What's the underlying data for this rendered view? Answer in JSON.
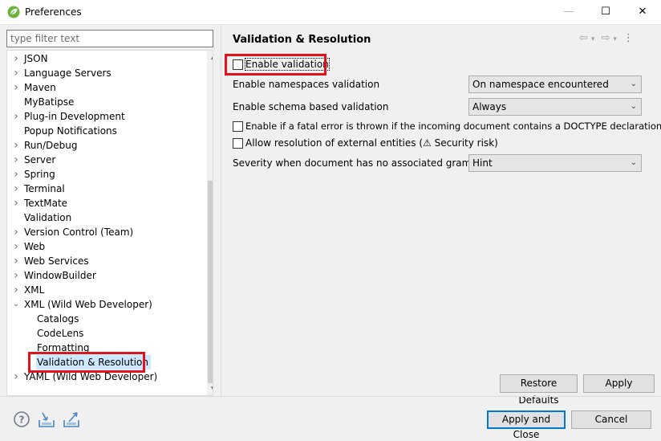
{
  "window": {
    "title": "Preferences",
    "minimize": "—",
    "maximize": "☐",
    "close": "✕"
  },
  "filter": {
    "placeholder": "type filter text"
  },
  "tree": {
    "items": [
      {
        "label": "JSON",
        "expandable": true
      },
      {
        "label": "Language Servers",
        "expandable": true
      },
      {
        "label": "Maven",
        "expandable": true
      },
      {
        "label": "MyBatipse",
        "expandable": false
      },
      {
        "label": "Plug-in Development",
        "expandable": true
      },
      {
        "label": "Popup Notifications",
        "expandable": false
      },
      {
        "label": "Run/Debug",
        "expandable": true
      },
      {
        "label": "Server",
        "expandable": true
      },
      {
        "label": "Spring",
        "expandable": true
      },
      {
        "label": "Terminal",
        "expandable": true
      },
      {
        "label": "TextMate",
        "expandable": true
      },
      {
        "label": "Validation",
        "expandable": false
      },
      {
        "label": "Version Control (Team)",
        "expandable": true
      },
      {
        "label": "Web",
        "expandable": true
      },
      {
        "label": "Web Services",
        "expandable": true
      },
      {
        "label": "WindowBuilder",
        "expandable": true
      },
      {
        "label": "XML",
        "expandable": true
      },
      {
        "label": "XML (Wild Web Developer)",
        "expandable": true,
        "expanded": true
      },
      {
        "label": "Catalogs",
        "child": true
      },
      {
        "label": "CodeLens",
        "child": true
      },
      {
        "label": "Formatting",
        "child": true
      },
      {
        "label": "Validation & Resolution",
        "child": true,
        "selected": true
      },
      {
        "label": "YAML (Wild Web Developer)",
        "expandable": true
      }
    ]
  },
  "page": {
    "title": "Validation & Resolution",
    "nav_back": "⇦",
    "nav_forward": "⇨",
    "nav_dropdown": "▾",
    "menu": "⋮",
    "enable_validation": {
      "label": "Enable validation",
      "checked": false
    },
    "namespaces": {
      "label": "Enable namespaces validation",
      "value": "On namespace encountered"
    },
    "schema": {
      "label": "Enable schema based validation",
      "value": "Always"
    },
    "fatal_error": {
      "label": "Enable if a fatal error is thrown if the incoming document contains a DOCTYPE declaration",
      "checked": false
    },
    "external_entities": {
      "label": "Allow resolution of external entities (⚠ Security risk)",
      "checked": false
    },
    "severity": {
      "label": "Severity when document has no associated grammar",
      "value": "Hint"
    },
    "restore_defaults": "Restore Defaults",
    "apply": "Apply"
  },
  "footer": {
    "help_icon": "help-icon",
    "import_icon": "import-icon",
    "export_icon": "export-icon",
    "apply_close": "Apply and Close",
    "cancel": "Cancel"
  },
  "colors": {
    "highlight": "#e3131e",
    "selection": "#cde8ff",
    "focus_border": "#0078d7"
  }
}
